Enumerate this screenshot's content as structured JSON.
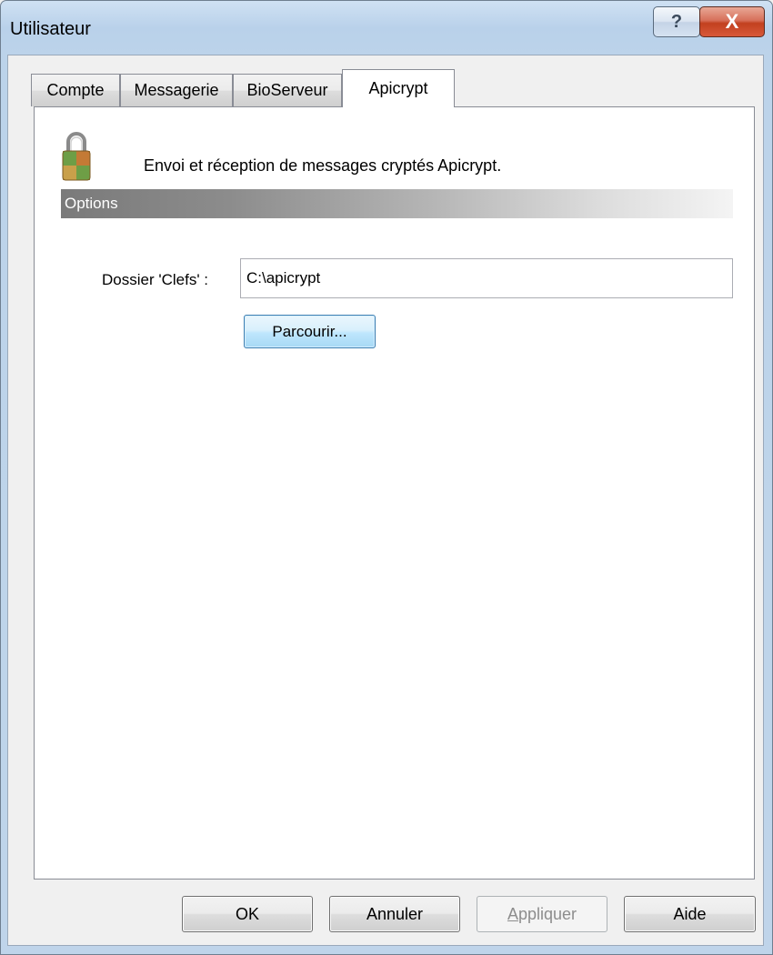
{
  "window": {
    "title": "Utilisateur",
    "help_button_glyph": "?",
    "close_button_glyph": "X"
  },
  "tabs": [
    {
      "label": "Compte",
      "active": false
    },
    {
      "label": "Messagerie",
      "active": false
    },
    {
      "label": "BioServeur",
      "active": false
    },
    {
      "label": "Apicrypt",
      "active": true
    }
  ],
  "panel": {
    "icon": "lock-icon",
    "description": "Envoi et réception de messages cryptés Apicrypt.",
    "section_title": "Options",
    "folder_label": "Dossier 'Clefs' :",
    "folder_value": "C:\\apicrypt",
    "browse_label": "Parcourir..."
  },
  "buttons": {
    "ok": "OK",
    "cancel": "Annuler",
    "apply_mnemonic": "A",
    "apply_rest": "ppliquer",
    "help": "Aide"
  },
  "colors": {
    "title_bar": "#bcd3ea",
    "close_button": "#c2401f",
    "options_bar_start": "#7a7a7a",
    "default_button": "#bee6fd"
  }
}
